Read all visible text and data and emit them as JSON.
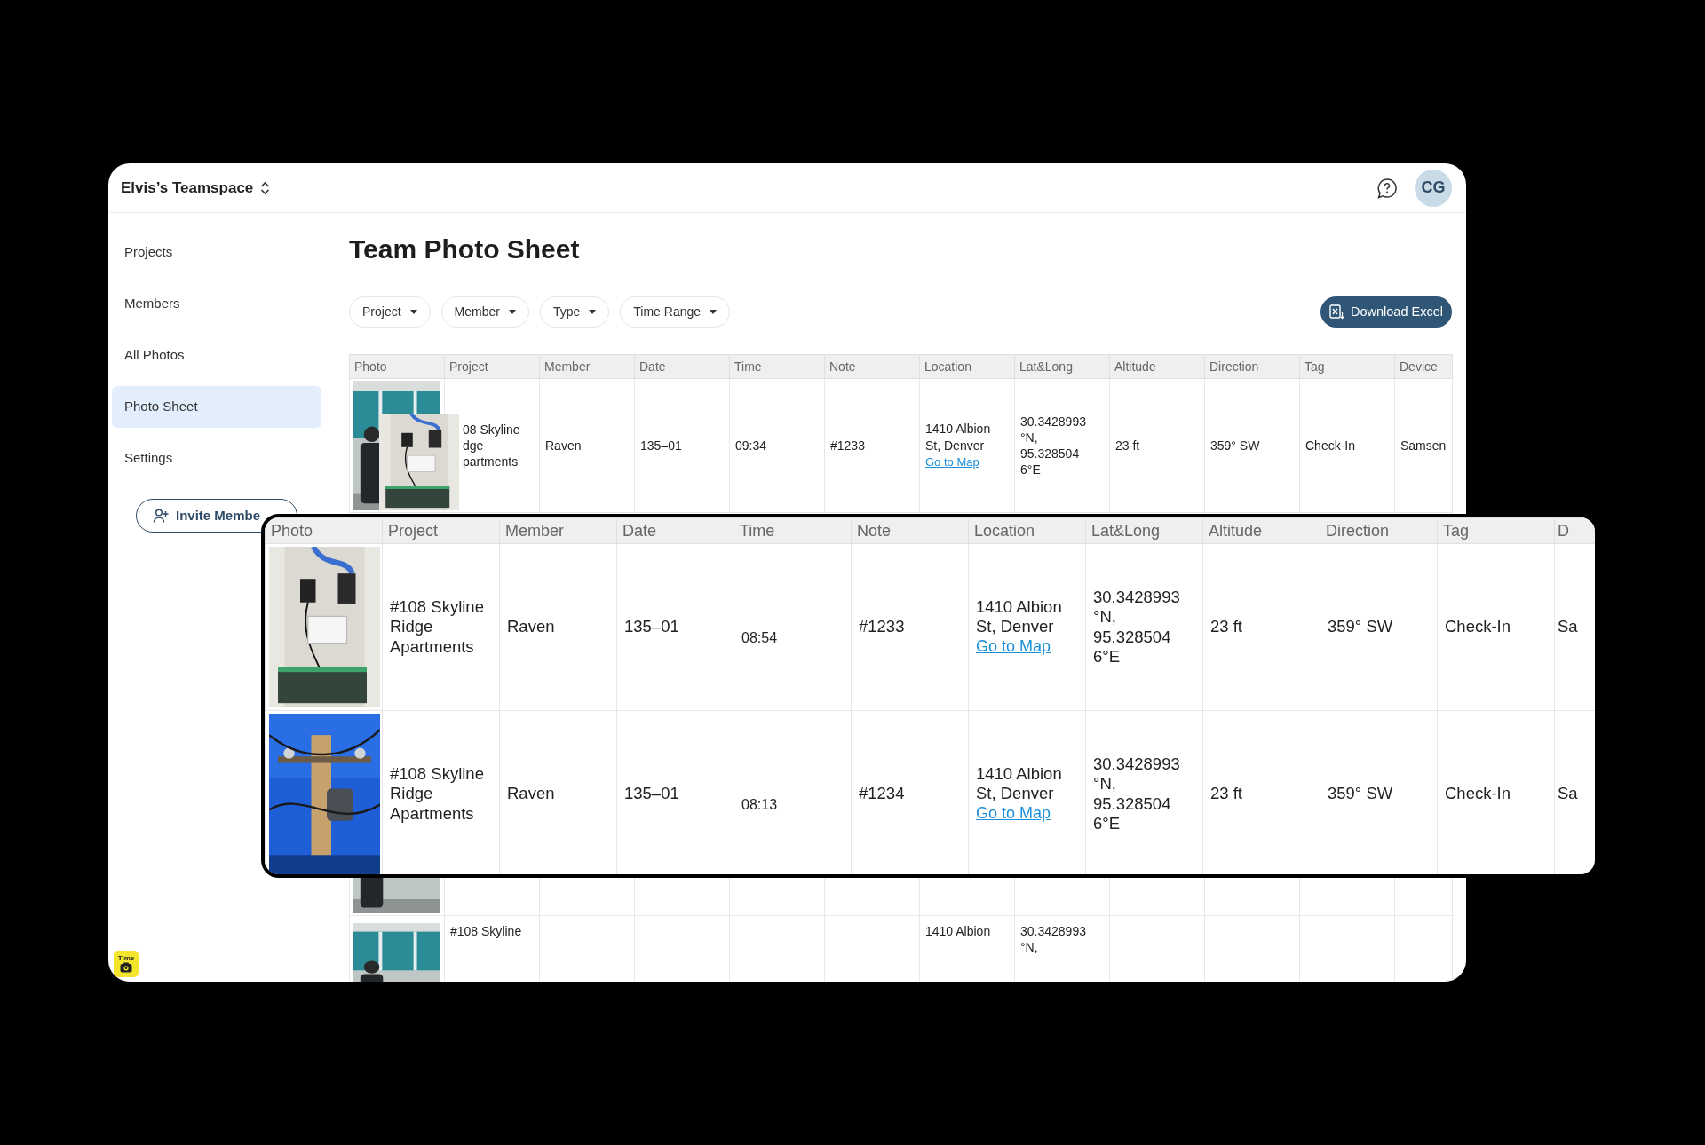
{
  "workspace": {
    "name": "Elvis’s Teamspace"
  },
  "header": {
    "avatar": "CG"
  },
  "sidebar": {
    "items": [
      {
        "label": "Projects",
        "selected": false
      },
      {
        "label": "Members",
        "selected": false
      },
      {
        "label": "All Photos",
        "selected": false
      },
      {
        "label": "Photo Sheet",
        "selected": true
      },
      {
        "label": "Settings",
        "selected": false
      }
    ],
    "invite_button": "Invite Membe",
    "logo": "Time"
  },
  "page_title": "Team Photo Sheet",
  "filters": [
    "Project",
    "Member",
    "Type",
    "Time Range"
  ],
  "download_button": "Download Excel",
  "table": {
    "columns": [
      "Photo",
      "Project",
      "Member",
      "Date",
      "Time",
      "Note",
      "Location",
      "Lat&Long",
      "Altitude",
      "Direction",
      "Tag",
      "Device"
    ],
    "rows": [
      {
        "photo": {
          "kind": "picture"
        },
        "project": [
          "08 Skyline",
          "dge",
          "partments"
        ],
        "member": [
          "Raven"
        ],
        "date": [
          "135–01"
        ],
        "time": [
          "09:34"
        ],
        "note": [
          "#1233"
        ],
        "location": {
          "lines": [
            "1410 Albion",
            "St, Denver"
          ],
          "link": "Go to Map"
        },
        "lat_long": [
          "30.3428993",
          "°N,",
          "95.328504",
          "6°E"
        ],
        "altitude": [
          "23 ft"
        ],
        "direction": [
          "359° SW"
        ],
        "tag": [
          "Check-In"
        ],
        "device": [
          "Samsen"
        ]
      },
      {
        "photo": {
          "kind": "picture"
        }
      },
      {
        "photo": {
          "kind": "picture"
        },
        "project": [
          "#108 Skyline"
        ],
        "location": {
          "lines": [
            "1410 Albion"
          ]
        },
        "lat_long": [
          "30.3428993",
          "°N,"
        ]
      }
    ]
  },
  "inset_table": {
    "columns": [
      "Photo",
      "Project",
      "Member",
      "Date",
      "Time",
      "Note",
      "Location",
      "Lat&Long",
      "Altitude",
      "Direction",
      "Tag",
      "D"
    ],
    "rows": [
      {
        "photo": {
          "kind": "picture"
        },
        "project": [
          "#108 Skyline",
          "Ridge",
          "Apartments"
        ],
        "member": [
          "Raven"
        ],
        "date": [
          "135–01"
        ],
        "time": [
          "08:54"
        ],
        "note": [
          "#1233"
        ],
        "location": {
          "lines": [
            "1410 Albion",
            "St, Denver"
          ],
          "link": "Go to Map"
        },
        "lat_long": [
          "30.3428993",
          "°N,",
          "95.328504",
          "6°E"
        ],
        "altitude": [
          "23 ft"
        ],
        "direction": [
          "359° SW"
        ],
        "tag": [
          "Check-In"
        ],
        "column_12": [
          "Sa"
        ]
      },
      {
        "photo": {
          "kind": "picture"
        },
        "project": [
          "#108 Skyline",
          "Ridge",
          "Apartments"
        ],
        "member": [
          "Raven"
        ],
        "date": [
          "135–01"
        ],
        "time": [
          "08:13"
        ],
        "note": [
          "#1234"
        ],
        "location": {
          "lines": [
            "1410 Albion",
            "St, Denver"
          ],
          "link": "Go to Map"
        },
        "lat_long": [
          "30.3428993",
          "°N,",
          "95.328504",
          "6°E"
        ],
        "altitude": [
          "23 ft"
        ],
        "direction": [
          "359° SW"
        ],
        "tag": [
          "Check-In"
        ],
        "column_12": [
          "Sa"
        ]
      }
    ]
  }
}
